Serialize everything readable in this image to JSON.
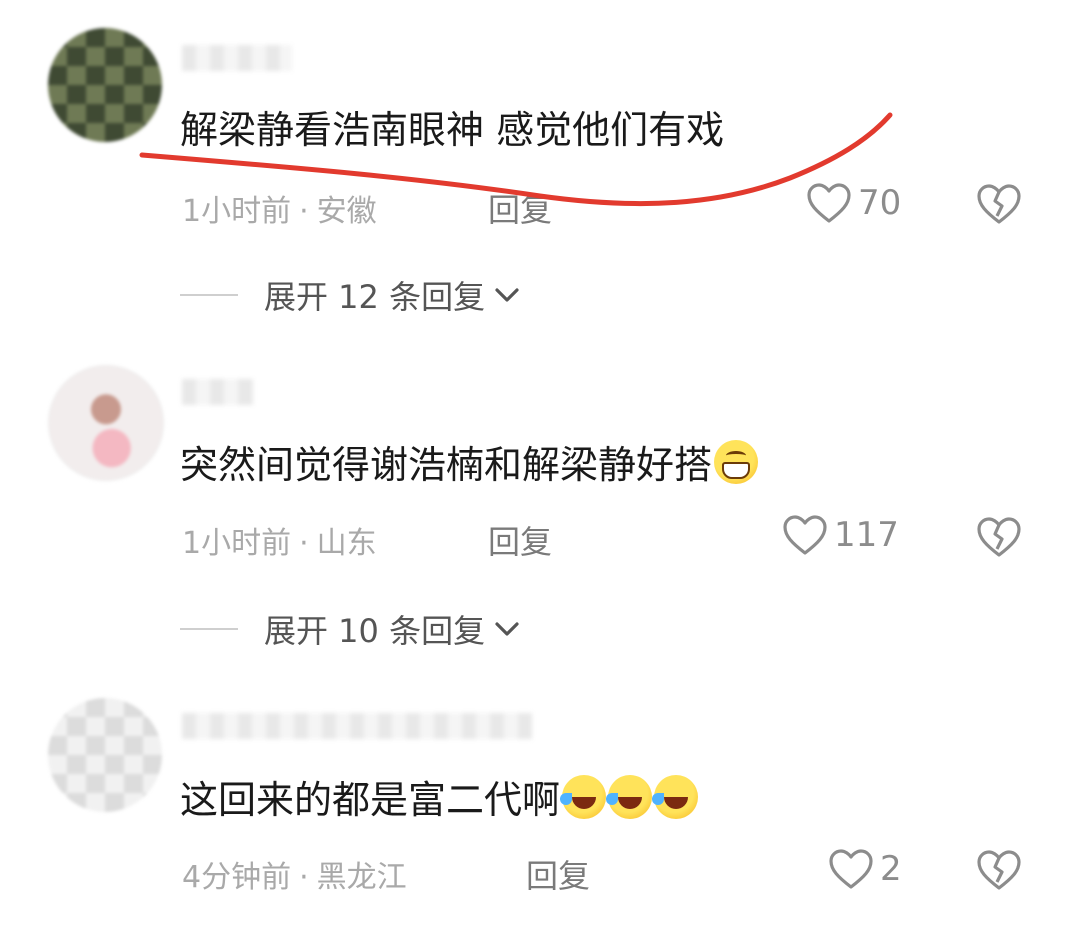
{
  "comments": [
    {
      "content": "解梁静看浩南眼神 感觉他们有戏",
      "time": "1小时前",
      "location": "安徽",
      "reply_label": "回复",
      "likes": "70",
      "expand_label": "展开 12 条回复",
      "annotation": "red-underline"
    },
    {
      "content": "突然间觉得谢浩楠和解梁静好搭",
      "emoji": [
        "grin-emoji"
      ],
      "time": "1小时前",
      "location": "山东",
      "reply_label": "回复",
      "likes": "117",
      "expand_label": "展开 10 条回复"
    },
    {
      "content": "这回来的都是富二代啊",
      "emoji": [
        "laugh-cry-emoji",
        "laugh-cry-emoji",
        "laugh-cry-emoji"
      ],
      "time": "4分钟前",
      "location": "黑龙江",
      "reply_label": "回复",
      "likes": "2"
    }
  ],
  "separator": "·",
  "icons": {
    "like": "heart-outline-icon",
    "dislike": "broken-heart-icon",
    "expand": "chevron-down-icon"
  },
  "colors": {
    "annotation_red": "#e23a2e",
    "meta_gray": "#a9a9a9",
    "text": "#1a1a1a"
  }
}
